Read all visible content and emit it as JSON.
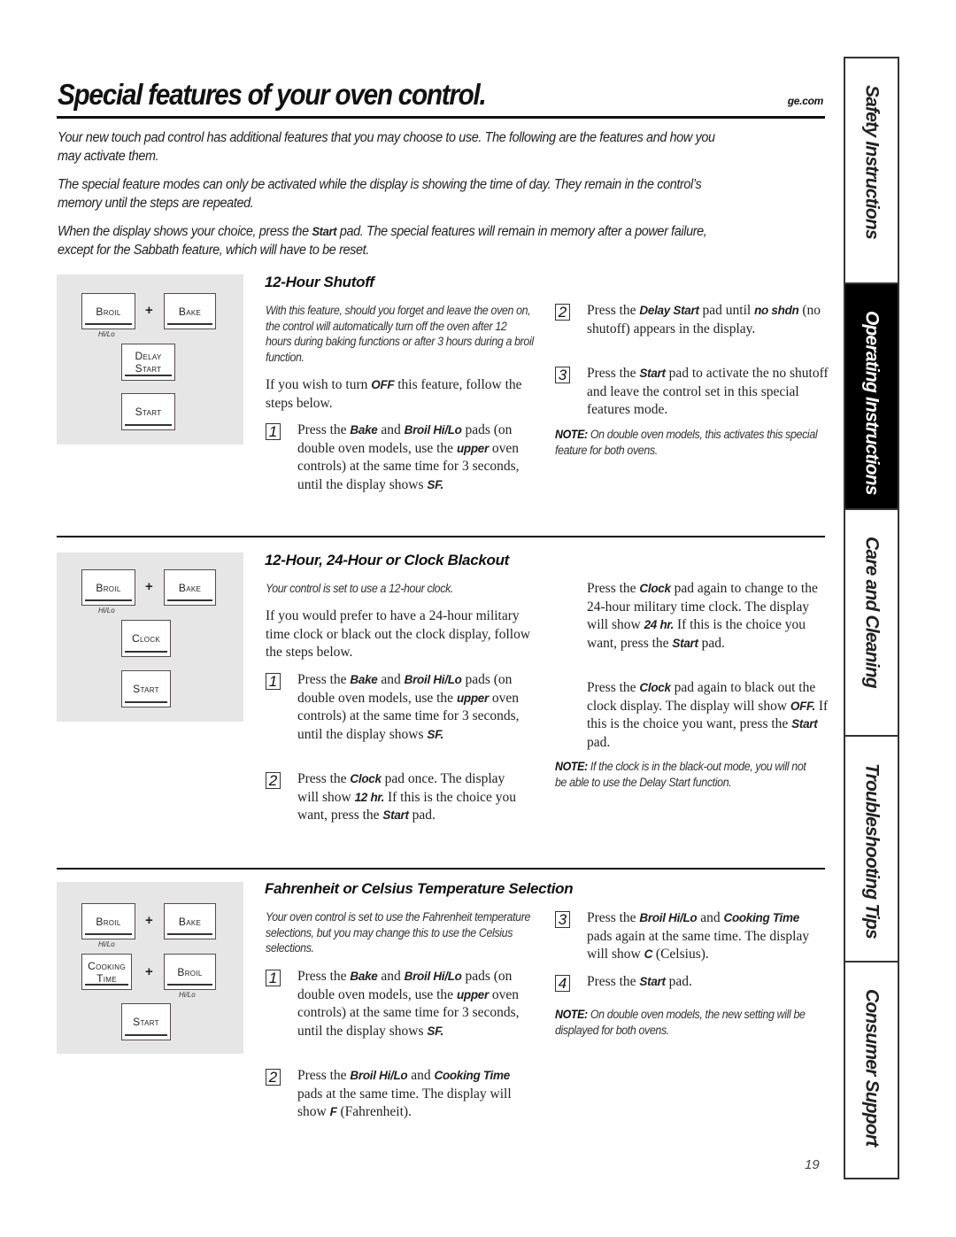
{
  "header": {
    "title": "Special features of your oven control.",
    "site": "ge.com"
  },
  "intro": {
    "p1": "Your new touch pad control has additional features that you may choose to use. The following are the features and how you may activate them.",
    "p2": "The special feature modes can only be activated while the display is showing the time of day. They remain in the control’s memory until the steps are repeated.",
    "p3_before": "When the display shows your choice, press the ",
    "p3_bold": "Start",
    "p3_after": " pad. The special features will remain in memory after a power failure, except for the Sabbath feature, which will have to be reset."
  },
  "pads": {
    "broil": "Broil",
    "bake": "Bake",
    "hilo": "Hi/Lo",
    "delay": "Delay",
    "start_word": "Start",
    "start": "Start",
    "clock": "Clock",
    "cooking": "Cooking",
    "time": "Time",
    "plus": "+"
  },
  "sections": {
    "shutoff": {
      "title": "12-Hour Shutoff",
      "lead": "With this feature, should you forget and leave the oven on, the control will automatically turn off the oven after 12 hours during baking functions or after 3 hours during a broil function.",
      "intro_a": "If you wish to turn ",
      "intro_b": "OFF",
      "intro_c": " this feature, follow the steps below.",
      "steps": [
        {
          "num": "1",
          "parts": [
            "Press the ",
            "Bake",
            " and ",
            "Broil Hi/Lo",
            " pads (on double oven models, use the ",
            "upper",
            " oven controls) at the same time for 3 seconds, until the display shows ",
            "SF."
          ]
        },
        {
          "num": "2",
          "parts": [
            "Press the ",
            "Delay Start",
            " pad until ",
            "no shdn",
            " (no shutoff) appears in the display."
          ]
        },
        {
          "num": "3",
          "parts": [
            "Press the ",
            "Start",
            " pad to activate the no shutoff and leave the control set in this special features mode."
          ]
        }
      ],
      "note_label": "NOTE:",
      "note": " On double oven models, this activates this special feature for both ovens."
    },
    "clock": {
      "title": "12-Hour, 24-Hour or Clock Blackout",
      "lead": "Your control is set to use a 12-hour clock.",
      "intro": "If you would prefer to have a 24-hour military time clock or black out the clock display, follow the steps below.",
      "steps": [
        {
          "num": "1",
          "parts": [
            "Press the ",
            "Bake",
            " and ",
            "Broil Hi/Lo",
            " pads (on double oven models, use the ",
            "upper",
            " oven controls) at the same time for 3 seconds, until the display shows ",
            "SF."
          ]
        },
        {
          "num": "2",
          "parts": [
            "Press the ",
            "Clock",
            " pad once. The display will show ",
            "12 hr.",
            " If this is the choice you want, press the ",
            "Start",
            " pad."
          ]
        }
      ],
      "cont1": [
        "Press the ",
        "Clock",
        " pad again to change to the 24-hour military time clock. The display will show ",
        "24 hr.",
        " If this is the choice you want, press the ",
        "Start",
        " pad."
      ],
      "cont2": [
        "Press the ",
        "Clock",
        " pad again to black out the clock display. The display will show ",
        "OFF.",
        " If this is the choice you want, press the ",
        "Start",
        " pad."
      ],
      "note_label": "NOTE:",
      "note": " If the clock is in the black-out mode, you will not be able to use the Delay Start function."
    },
    "temp": {
      "title": "Fahrenheit or Celsius Temperature Selection",
      "lead": "Your oven control is set to use the Fahrenheit temperature selections, but you may change this to use the Celsius selections.",
      "steps": [
        {
          "num": "1",
          "parts": [
            "Press the ",
            "Bake",
            " and ",
            "Broil Hi/Lo",
            " pads (on double oven models, use the ",
            "upper",
            " oven controls) at the same time for 3 seconds, until the display shows ",
            "SF."
          ]
        },
        {
          "num": "2",
          "parts": [
            "Press the ",
            "Broil Hi/Lo",
            " and ",
            "Cooking Time",
            " pads at the same time. The display will show ",
            "F",
            " (Fahrenheit)."
          ]
        },
        {
          "num": "3",
          "parts": [
            "Press the ",
            "Broil Hi/Lo",
            " and ",
            "Cooking Time",
            " pads again at the same time. The display will show ",
            "C",
            " (Celsius)."
          ]
        },
        {
          "num": "4",
          "parts": [
            "Press the ",
            "Start",
            " pad."
          ]
        }
      ],
      "note_label": "NOTE:",
      "note": " On double oven models, the new setting will be displayed for both ovens."
    }
  },
  "side_tabs": [
    {
      "label": "Safety Instructions",
      "active": false
    },
    {
      "label": "Operating Instructions",
      "active": true
    },
    {
      "label": "Care and Cleaning",
      "active": false
    },
    {
      "label": "Troubleshooting Tips",
      "active": false
    },
    {
      "label": "Consumer Support",
      "active": false
    }
  ],
  "page_number": "19"
}
